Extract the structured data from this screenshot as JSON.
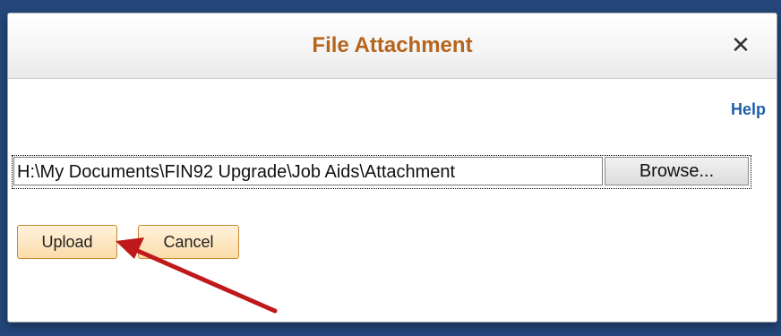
{
  "dialog": {
    "title": "File Attachment",
    "close_glyph": "✕",
    "help_label": "Help",
    "file_path": "H:\\My Documents\\FIN92 Upgrade\\Job Aids\\Attachment",
    "browse_label": "Browse...",
    "upload_label": "Upload",
    "cancel_label": "Cancel"
  },
  "colors": {
    "title": "#b5651d",
    "help_link": "#1f5fa8",
    "button_border": "#cc8a33",
    "annotation_arrow": "#c0191b"
  },
  "icons": {
    "close": "close-icon",
    "annotation": "arrow-annotation-icon"
  }
}
